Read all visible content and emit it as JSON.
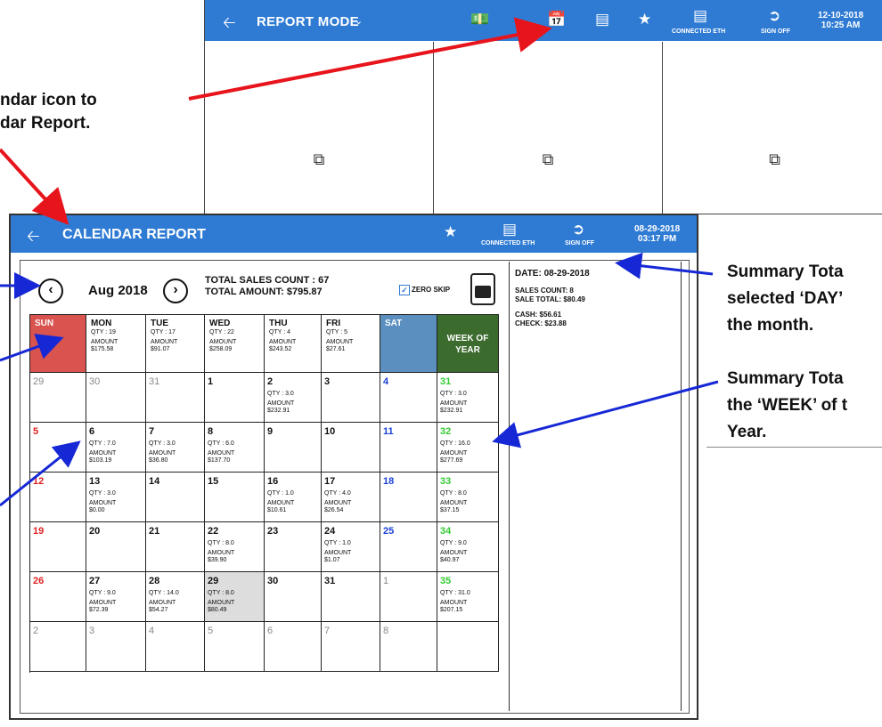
{
  "report_mode": {
    "title": "REPORT MODE",
    "connected_label": "CONNECTED ETH",
    "signoff_label": "SIGN OFF",
    "date": "12-10-2018",
    "time": "10:25 AM"
  },
  "annotations": {
    "top_left": [
      "ndar icon to",
      "dar Report."
    ],
    "right_day": [
      "Summary Tota",
      "selected ‘DAY’",
      "the month."
    ],
    "right_week": [
      "Summary Tota",
      "the ‘WEEK’ of t",
      "Year."
    ]
  },
  "calendar": {
    "title": "CALENDAR REPORT",
    "connected_label": "CONNECTED ETH",
    "signoff_label": "SIGN OFF",
    "date": "08-29-2018",
    "time": "03:17 PM",
    "month": "Aug 2018",
    "total_sales": "TOTAL SALES COUNT : 67",
    "total_amount": "TOTAL AMOUNT: $795.87",
    "zero_skip": "ZERO SKIP",
    "headers": [
      {
        "name": "SUN",
        "qty": "",
        "amt_label": "",
        "amt": ""
      },
      {
        "name": "MON",
        "qty": "QTY : 19",
        "amt_label": "AMOUNT",
        "amt": "$175.58"
      },
      {
        "name": "TUE",
        "qty": "QTY : 17",
        "amt_label": "AMOUNT",
        "amt": "$91.07"
      },
      {
        "name": "WED",
        "qty": "QTY : 22",
        "amt_label": "AMOUNT",
        "amt": "$258.09"
      },
      {
        "name": "THU",
        "qty": "QTY : 4",
        "amt_label": "AMOUNT",
        "amt": "$243.52"
      },
      {
        "name": "FRI",
        "qty": "QTY : 5",
        "amt_label": "AMOUNT",
        "amt": "$27.61"
      },
      {
        "name": "SAT",
        "qty": "",
        "amt_label": "",
        "amt": ""
      },
      {
        "name": "WEEK OF YEAR",
        "qty": "",
        "amt_label": "",
        "amt": ""
      }
    ],
    "colors": {
      "sun": "#d9534f",
      "sat": "#5b8fbf",
      "week": "#3c6b2e",
      "selected": "#dddddd",
      "green": "#33cc33",
      "red": "#e02020",
      "blue": "#1a3fd6",
      "grey": "#888888"
    },
    "rows": [
      [
        {
          "d": "29"
        },
        {
          "d": "30"
        },
        {
          "d": "31"
        },
        {
          "d": "1"
        },
        {
          "d": "2",
          "q": "QTY : 3.0",
          "a": "$232.91"
        },
        {
          "d": "3"
        },
        {
          "d": "4"
        },
        {
          "d": "31",
          "q": "QTY : 3.0",
          "a": "$232.91"
        }
      ],
      [
        {
          "d": "5"
        },
        {
          "d": "6",
          "q": "QTY : 7.0",
          "a": "$103.19"
        },
        {
          "d": "7",
          "q": "QTY : 3.0",
          "a": "$36.80"
        },
        {
          "d": "8",
          "q": "QTY : 6.0",
          "a": "$137.70"
        },
        {
          "d": "9"
        },
        {
          "d": "10"
        },
        {
          "d": "11"
        },
        {
          "d": "32",
          "q": "QTY : 16.0",
          "a": "$277.69"
        }
      ],
      [
        {
          "d": "12"
        },
        {
          "d": "13",
          "q": "QTY : 3.0",
          "a": "$0.00"
        },
        {
          "d": "14"
        },
        {
          "d": "15"
        },
        {
          "d": "16",
          "q": "QTY : 1.0",
          "a": "$10.61"
        },
        {
          "d": "17",
          "q": "QTY : 4.0",
          "a": "$26.54"
        },
        {
          "d": "18"
        },
        {
          "d": "33",
          "q": "QTY : 8.0",
          "a": "$37.15"
        }
      ],
      [
        {
          "d": "19"
        },
        {
          "d": "20"
        },
        {
          "d": "21"
        },
        {
          "d": "22",
          "q": "QTY : 8.0",
          "a": "$39.90"
        },
        {
          "d": "23"
        },
        {
          "d": "24",
          "q": "QTY : 1.0",
          "a": "$1.07"
        },
        {
          "d": "25"
        },
        {
          "d": "34",
          "q": "QTY : 9.0",
          "a": "$40.97"
        }
      ],
      [
        {
          "d": "26"
        },
        {
          "d": "27",
          "q": "QTY : 9.0",
          "a": "$72.39"
        },
        {
          "d": "28",
          "q": "QTY : 14.0",
          "a": "$54.27"
        },
        {
          "d": "29",
          "q": "QTY : 8.0",
          "a": "$80.49"
        },
        {
          "d": "30"
        },
        {
          "d": "31"
        },
        {
          "d": "1"
        },
        {
          "d": "35",
          "q": "QTY : 31.0",
          "a": "$207.15"
        }
      ],
      [
        {
          "d": "2"
        },
        {
          "d": "3"
        },
        {
          "d": "4"
        },
        {
          "d": "5"
        },
        {
          "d": "6"
        },
        {
          "d": "7"
        },
        {
          "d": "8"
        },
        {
          "d": ""
        }
      ]
    ],
    "amount_label": "AMOUNT",
    "summary": {
      "date": "DATE: 08-29-2018",
      "sales_count": "SALES COUNT: 8",
      "sale_total": "SALE TOTAL: $80.49",
      "cash": "CASH: $56.61",
      "check": "CHECK: $23.88"
    }
  }
}
